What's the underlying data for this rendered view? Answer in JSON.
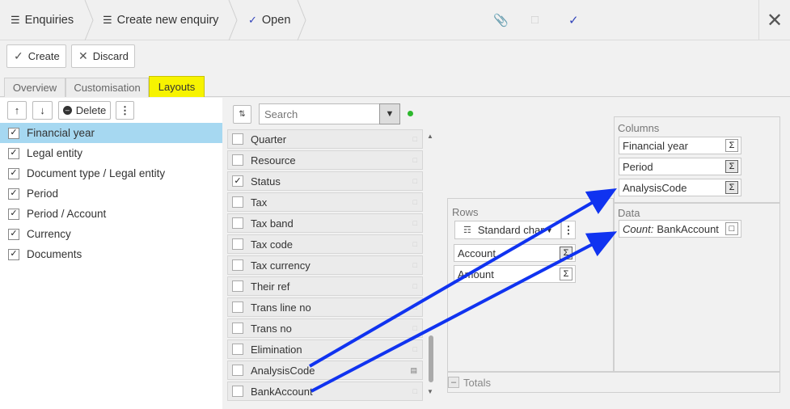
{
  "breadcrumbs": [
    {
      "label": "Enquiries",
      "icon": "filter-list-icon"
    },
    {
      "label": "Create new enquiry",
      "icon": "filter-list-icon"
    },
    {
      "label": "Open",
      "icon": "check-chart-icon"
    }
  ],
  "toolbar": {
    "create_label": "Create",
    "discard_label": "Discard"
  },
  "tabs": [
    {
      "label": "Overview",
      "active": false
    },
    {
      "label": "Customisation",
      "active": false
    },
    {
      "label": "Layouts",
      "active": true
    }
  ],
  "left_panel": {
    "delete_label": "Delete",
    "items": [
      {
        "label": "Financial year",
        "checked": true,
        "selected": true
      },
      {
        "label": "Legal entity",
        "checked": true,
        "selected": false
      },
      {
        "label": "Document type / Legal entity",
        "checked": true,
        "selected": false
      },
      {
        "label": "Period",
        "checked": true,
        "selected": false
      },
      {
        "label": "Period / Account",
        "checked": true,
        "selected": false
      },
      {
        "label": "Currency",
        "checked": true,
        "selected": false
      },
      {
        "label": "Documents",
        "checked": true,
        "selected": false
      }
    ]
  },
  "field_list": {
    "search_placeholder": "Search",
    "fields": [
      {
        "label": "Quarter",
        "checked": false
      },
      {
        "label": "Resource",
        "checked": false
      },
      {
        "label": "Status",
        "checked": true
      },
      {
        "label": "Tax",
        "checked": false
      },
      {
        "label": "Tax band",
        "checked": false
      },
      {
        "label": "Tax code",
        "checked": false
      },
      {
        "label": "Tax currency",
        "checked": false
      },
      {
        "label": "Their ref",
        "checked": false
      },
      {
        "label": "Trans line no",
        "checked": false
      },
      {
        "label": "Trans no",
        "checked": false
      },
      {
        "label": "Elimination",
        "checked": false
      },
      {
        "label": "AnalysisCode",
        "checked": false
      },
      {
        "label": "BankAccount",
        "checked": false
      }
    ]
  },
  "pivot": {
    "columns_label": "Columns",
    "columns": [
      "Financial year",
      "Period",
      "AnalysisCode"
    ],
    "rows_label": "Rows",
    "row_chart_label": "Standard chart",
    "rows": [
      "Account",
      "Amount"
    ],
    "data_label": "Data",
    "data_prefix": "Count:",
    "data_field": "BankAccount",
    "totals_label": "Totals"
  },
  "colors": {
    "selected_row": "#a6d8f1",
    "active_tab": "#f7f300",
    "arrow": "#1033f0",
    "status_dot": "#2db82d"
  }
}
